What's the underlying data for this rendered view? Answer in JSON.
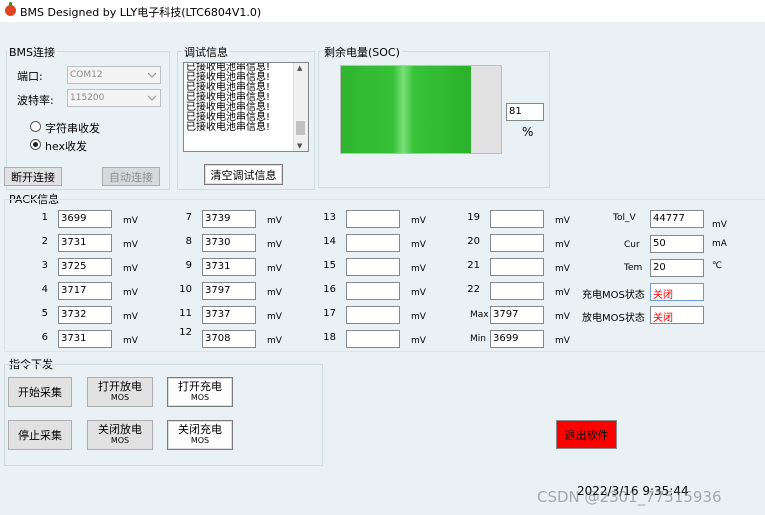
{
  "window": {
    "title": "BMS Designed by LLY电子科技(LTC6804V1.0)"
  },
  "bms_conn": {
    "group_label": "BMS连接",
    "port_label": "端口:",
    "port_value": "COM12",
    "baud_label": "波特率:",
    "baud_value": "115200",
    "radio_string": "字符串收发",
    "radio_hex": "hex收发",
    "disconnect_btn": "断开连接",
    "autoconnect_btn": "自动连接"
  },
  "debug": {
    "group_label": "调试信息",
    "log_lines": [
      "已接收电池串信息!",
      "已接收电池串信息!",
      "已接收电池串信息!",
      "已接收电池串信息!",
      "已接收电池串信息!",
      "已接收电池串信息!",
      "已接收电池串信息!"
    ],
    "clear_btn": "清空调试信息"
  },
  "soc": {
    "group_label": "剩余电量(SOC)",
    "value": "81",
    "unit": "%",
    "fill_percent": 81
  },
  "pack": {
    "group_label": "PACK信息",
    "cells": [
      {
        "n": "1",
        "v": "3699"
      },
      {
        "n": "2",
        "v": "3731"
      },
      {
        "n": "3",
        "v": "3725"
      },
      {
        "n": "4",
        "v": "3717"
      },
      {
        "n": "5",
        "v": "3732"
      },
      {
        "n": "6",
        "v": "3731"
      },
      {
        "n": "7",
        "v": "3739"
      },
      {
        "n": "8",
        "v": "3730"
      },
      {
        "n": "9",
        "v": "3731"
      },
      {
        "n": "10",
        "v": "3797"
      },
      {
        "n": "11",
        "v": "3737"
      },
      {
        "n": "12",
        "v": "3708"
      },
      {
        "n": "13",
        "v": ""
      },
      {
        "n": "14",
        "v": ""
      },
      {
        "n": "15",
        "v": ""
      },
      {
        "n": "16",
        "v": ""
      },
      {
        "n": "17",
        "v": ""
      },
      {
        "n": "18",
        "v": ""
      },
      {
        "n": "19",
        "v": ""
      },
      {
        "n": "20",
        "v": ""
      },
      {
        "n": "21",
        "v": ""
      },
      {
        "n": "22",
        "v": ""
      }
    ],
    "unit_mv": "mV",
    "max_label": "Max",
    "max_value": "3797",
    "min_label": "Min",
    "min_value": "3699",
    "tolv_label": "Tol_V",
    "tolv_value": "44777",
    "tolv_unit": "mV",
    "cur_label": "Cur",
    "cur_value": "50",
    "cur_unit": "mA",
    "tem_label": "Tem",
    "tem_value": "20",
    "tem_unit": "℃",
    "charge_mos_label": "充电MOS状态",
    "charge_mos_value": "关闭",
    "discharge_mos_label": "放电MOS状态",
    "discharge_mos_value": "关闭",
    "status_color": "#ff0000"
  },
  "commands": {
    "group_label": "指令下发",
    "start_collect": "开始采集",
    "stop_collect": "停止采集",
    "open_discharge": "打开放电",
    "close_discharge": "关闭放电",
    "open_charge": "打开充电",
    "close_charge": "关闭充电",
    "mos": "MOS",
    "exit_btn": "退出软件"
  },
  "status": {
    "datetime": "2022/3/16 9:35:44"
  },
  "watermark": "CSDN @2301_77515936",
  "colors": {
    "background": "#e9f1f4",
    "soc_bar": "#33bb33",
    "exit_button": "#ff0000"
  }
}
